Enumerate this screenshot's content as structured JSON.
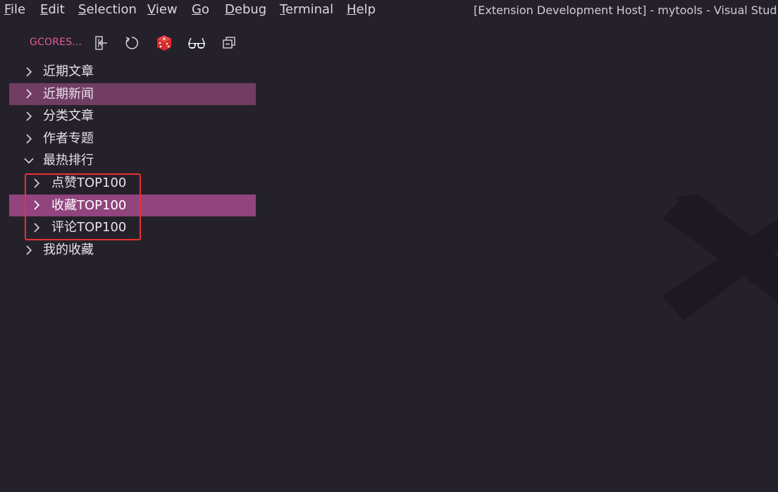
{
  "menubar": {
    "items": [
      {
        "mnemonic": "F",
        "rest": "ile"
      },
      {
        "mnemonic": "E",
        "rest": "dit"
      },
      {
        "mnemonic": "S",
        "rest": "election"
      },
      {
        "mnemonic": "V",
        "rest": "iew"
      },
      {
        "mnemonic": "G",
        "rest": "o"
      },
      {
        "mnemonic": "D",
        "rest": "ebug"
      },
      {
        "mnemonic": "T",
        "rest": "erminal"
      },
      {
        "mnemonic": "H",
        "rest": "elp"
      }
    ]
  },
  "window": {
    "title": "[Extension Development Host] - mytools - Visual Studio C"
  },
  "toolbar": {
    "section_title": "GCORES...",
    "icons": [
      "logout-icon",
      "refresh-icon",
      "dice-icon",
      "glasses-icon",
      "collapse-all-icon"
    ],
    "colors": {
      "title": "#e25b9b",
      "dice": "#d42b2b"
    }
  },
  "tree": {
    "items": [
      {
        "label": "近期文章",
        "expanded": false,
        "level": 0,
        "state": "normal"
      },
      {
        "label": "近期新闻",
        "expanded": false,
        "level": 0,
        "state": "selected"
      },
      {
        "label": "分类文章",
        "expanded": false,
        "level": 0,
        "state": "normal"
      },
      {
        "label": "作者专题",
        "expanded": false,
        "level": 0,
        "state": "normal"
      },
      {
        "label": "最热排行",
        "expanded": true,
        "level": 0,
        "state": "normal"
      },
      {
        "label": "点赞TOP100",
        "expanded": false,
        "level": 1,
        "state": "normal"
      },
      {
        "label": "收藏TOP100",
        "expanded": false,
        "level": 1,
        "state": "hover"
      },
      {
        "label": "评论TOP100",
        "expanded": false,
        "level": 1,
        "state": "normal"
      },
      {
        "label": "我的收藏",
        "expanded": false,
        "level": 0,
        "state": "normal"
      }
    ],
    "colors": {
      "selected": "#723d63",
      "hover": "#91447e",
      "highlight_box": "#e8322f"
    }
  },
  "editor": {
    "watermark": "vscode-logo-watermark"
  }
}
